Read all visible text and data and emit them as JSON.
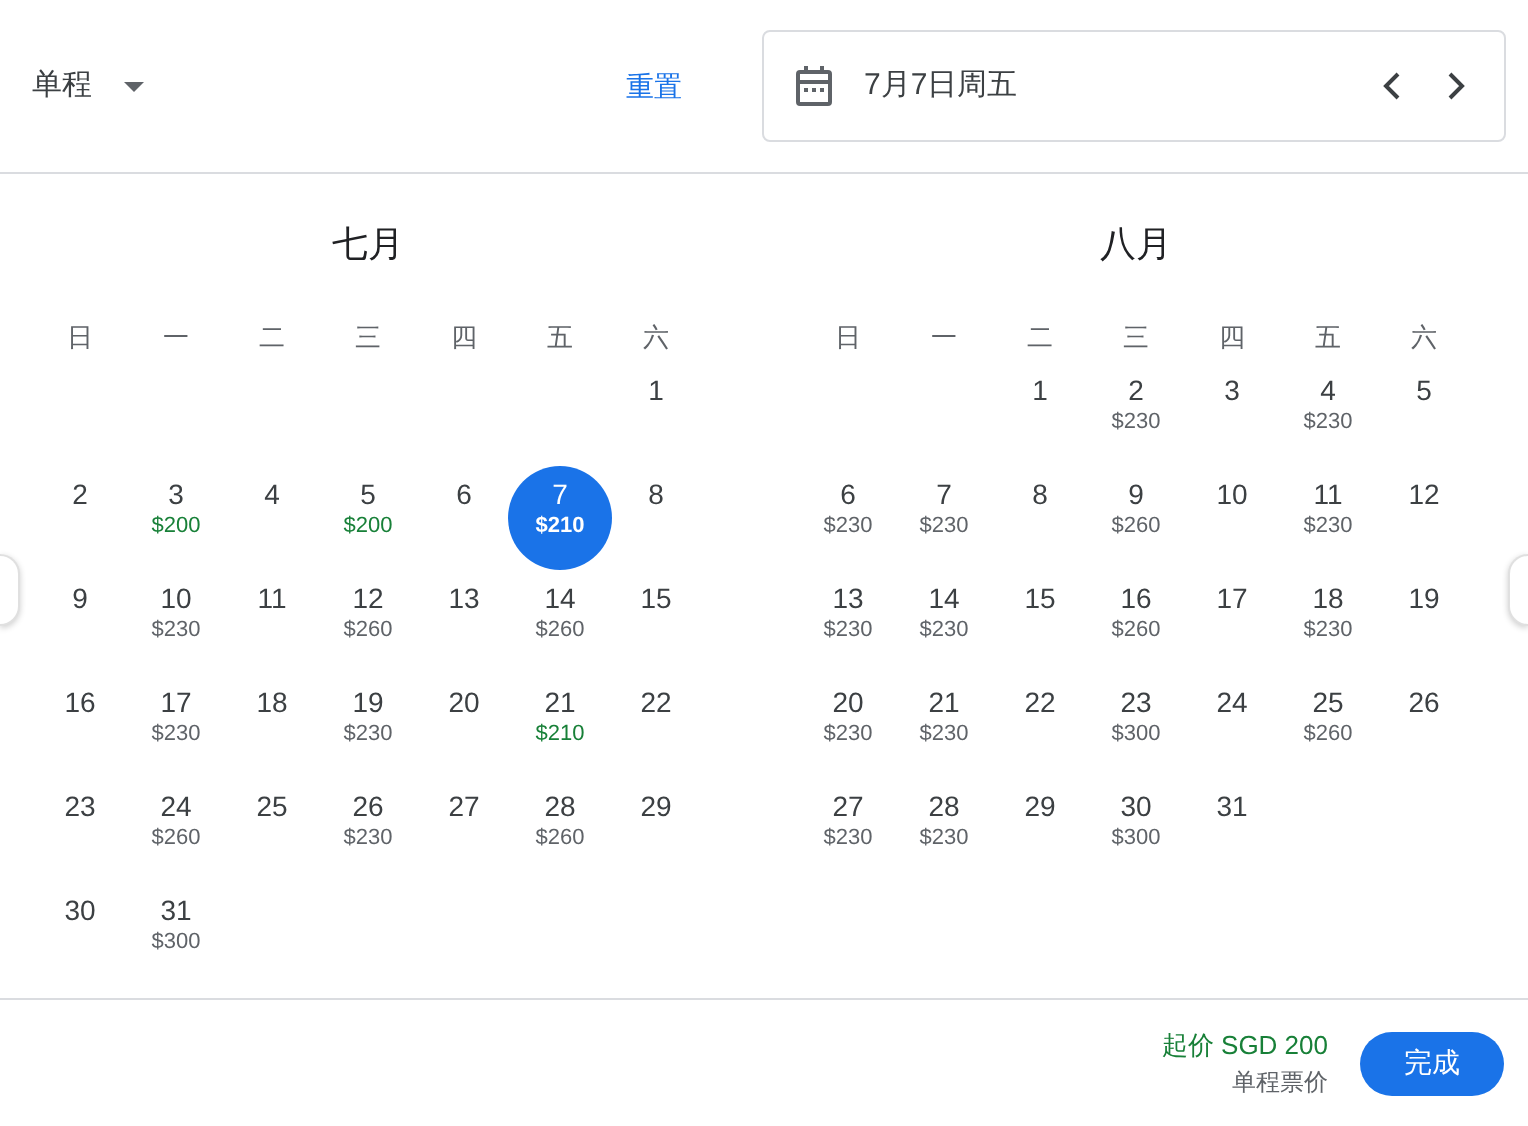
{
  "trip_type": {
    "label": "单程"
  },
  "reset_link": "重置",
  "date_field": {
    "value": "7月7日周五"
  },
  "months": [
    {
      "title": "七月",
      "weekdays": [
        "日",
        "一",
        "二",
        "三",
        "四",
        "五",
        "六"
      ],
      "weeks": [
        [
          {
            "day": "1",
            "selected": false
          }
        ],
        [
          {
            "day": "2",
            "selected": false
          },
          {
            "day": "3",
            "price": "$200",
            "cheap": true,
            "selected": false
          },
          {
            "day": "4",
            "selected": false
          },
          {
            "day": "5",
            "price": "$200",
            "cheap": true,
            "selected": false
          },
          {
            "day": "6",
            "selected": false
          },
          {
            "day": "7",
            "price": "$210",
            "cheap": true,
            "selected": true
          },
          {
            "day": "8",
            "selected": false
          }
        ],
        [
          {
            "day": "9",
            "selected": false
          },
          {
            "day": "10",
            "price": "$230",
            "cheap": false,
            "selected": false
          },
          {
            "day": "11",
            "selected": false
          },
          {
            "day": "12",
            "price": "$260",
            "cheap": false,
            "selected": false
          },
          {
            "day": "13",
            "selected": false
          },
          {
            "day": "14",
            "price": "$260",
            "cheap": false,
            "selected": false
          },
          {
            "day": "15",
            "selected": false
          }
        ],
        [
          {
            "day": "16",
            "selected": false
          },
          {
            "day": "17",
            "price": "$230",
            "cheap": false,
            "selected": false
          },
          {
            "day": "18",
            "selected": false
          },
          {
            "day": "19",
            "price": "$230",
            "cheap": false,
            "selected": false
          },
          {
            "day": "20",
            "selected": false
          },
          {
            "day": "21",
            "price": "$210",
            "cheap": true,
            "selected": false
          },
          {
            "day": "22",
            "selected": false
          }
        ],
        [
          {
            "day": "23",
            "selected": false
          },
          {
            "day": "24",
            "price": "$260",
            "cheap": false,
            "selected": false
          },
          {
            "day": "25",
            "selected": false
          },
          {
            "day": "26",
            "price": "$230",
            "cheap": false,
            "selected": false
          },
          {
            "day": "27",
            "selected": false
          },
          {
            "day": "28",
            "price": "$260",
            "cheap": false,
            "selected": false
          },
          {
            "day": "29",
            "selected": false
          }
        ],
        [
          {
            "day": "30",
            "selected": false
          },
          {
            "day": "31",
            "price": "$300",
            "cheap": false,
            "selected": false
          }
        ]
      ]
    },
    {
      "title": "八月",
      "weekdays": [
        "日",
        "一",
        "二",
        "三",
        "四",
        "五",
        "六"
      ],
      "weeks": [
        [
          {
            "day": "1",
            "selected": false
          },
          {
            "day": "2",
            "price": "$230",
            "cheap": false,
            "selected": false
          },
          {
            "day": "3",
            "selected": false
          },
          {
            "day": "4",
            "price": "$230",
            "cheap": false,
            "selected": false
          },
          {
            "day": "5",
            "selected": false
          }
        ],
        [
          {
            "day": "6",
            "price": "$230",
            "cheap": false,
            "selected": false
          },
          {
            "day": "7",
            "price": "$230",
            "cheap": false,
            "selected": false
          },
          {
            "day": "8",
            "selected": false
          },
          {
            "day": "9",
            "price": "$260",
            "cheap": false,
            "selected": false
          },
          {
            "day": "10",
            "selected": false
          },
          {
            "day": "11",
            "price": "$230",
            "cheap": false,
            "selected": false
          },
          {
            "day": "12",
            "selected": false
          }
        ],
        [
          {
            "day": "13",
            "price": "$230",
            "cheap": false,
            "selected": false
          },
          {
            "day": "14",
            "price": "$230",
            "cheap": false,
            "selected": false
          },
          {
            "day": "15",
            "selected": false
          },
          {
            "day": "16",
            "price": "$260",
            "cheap": false,
            "selected": false
          },
          {
            "day": "17",
            "selected": false
          },
          {
            "day": "18",
            "price": "$230",
            "cheap": false,
            "selected": false
          },
          {
            "day": "19",
            "selected": false
          }
        ],
        [
          {
            "day": "20",
            "price": "$230",
            "cheap": false,
            "selected": false
          },
          {
            "day": "21",
            "price": "$230",
            "cheap": false,
            "selected": false
          },
          {
            "day": "22",
            "selected": false
          },
          {
            "day": "23",
            "price": "$300",
            "cheap": false,
            "selected": false
          },
          {
            "day": "24",
            "selected": false
          },
          {
            "day": "25",
            "price": "$260",
            "cheap": false,
            "selected": false
          },
          {
            "day": "26",
            "selected": false
          }
        ],
        [
          {
            "day": "27",
            "price": "$230",
            "cheap": false,
            "selected": false
          },
          {
            "day": "28",
            "price": "$230",
            "cheap": false,
            "selected": false
          },
          {
            "day": "29",
            "selected": false
          },
          {
            "day": "30",
            "price": "$300",
            "cheap": false,
            "selected": false
          },
          {
            "day": "31",
            "selected": false
          }
        ]
      ]
    }
  ],
  "footer": {
    "price_from": "起价 SGD 200",
    "price_note": "单程票价",
    "done_button": "完成"
  }
}
